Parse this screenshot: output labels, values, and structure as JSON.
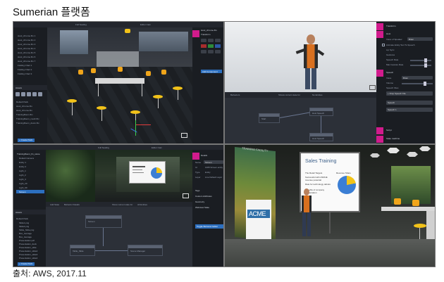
{
  "page": {
    "title": "Sumerian 플랫폼",
    "caption": "출처: AWS, 2017.11"
  },
  "editor1": {
    "toolbar": {
      "camera": "Full Seating",
      "editor_cam": "Editor Cam"
    },
    "inspector": {
      "file_name": "stool_chrome.fbx",
      "section": "Transform",
      "button": "Add Component"
    },
    "entities": [
      "stool_chrome.fbx 1",
      "stool_chrome.fbx 2",
      "stool_chrome.fbx 3",
      "stool_chrome.fbx 4",
      "stool_chrome.fbx 5",
      "stool_chrome.fbx 6",
      "stool_chrome.fbx 7",
      "Folding Chair 1",
      "Folding Chair 2",
      "Folding Chair 3"
    ],
    "assets_label": "Assets",
    "assets": [
      "Default Pack",
      "stool_chrome.fbx",
      "stool_chrome.fbx",
      "TrainingRoom.fbx",
      "TrainingRoom_mesh.fbx",
      "TrainingRoom_doors.fbx"
    ],
    "create_pack": "+ Create Pack"
  },
  "editor2": {
    "panel": {
      "section_transform": "Transform",
      "section_host": "Host",
      "voice_label": "Voice of Speaker",
      "voice_value": "Brian",
      "option1": "Animate Entity Text To Speech",
      "option2": "Lip Sync",
      "option3": "Gestures",
      "option4": "Speech Rate",
      "option5": "Max Gesture Rate",
      "section_speech": "Speech",
      "voice2_label": "Voice",
      "voice2_value": "Brian",
      "volume_label": "Volume",
      "speech_files": "Speech Files",
      "drop_label": "+ Drop Speech File",
      "speech1": "Speech",
      "speech2": "Speech 1",
      "section_script": "Script",
      "section_state": "State machine"
    },
    "lower_toolbar": {
      "tab1": "Behaviors",
      "tab2": "Shows current state for",
      "tab3": "No Entities"
    },
    "nodes": [
      "Start",
      "Host Speech",
      "Host Speech"
    ]
  },
  "editor3": {
    "toolbar": {
      "camera": "Full Seating",
      "editor_cam": "Editor Cam"
    },
    "entities": [
      "TrainingRoom_fin_stone",
      "Default Camera",
      "Entity 1",
      "Entity 2",
      "Light_1",
      "Light_2",
      "Light_3",
      "Light_20",
      "Light_99",
      "Screen"
    ],
    "inspector": {
      "section_details": "Details",
      "name_label": "Name",
      "name_value": "Screen",
      "id_label": "Id",
      "id_value": "1005.Screen.entity",
      "type_label": "Type",
      "type_value": "Entity",
      "layer_label": "Layer",
      "layer_value": "Live Default Layer",
      "section_tags": "Tags",
      "section_attributes": "Custom Attributes",
      "section_geometry": "Geometry",
      "section_webview": "Webview State",
      "button": "Toggle Behavior Editor"
    },
    "lower_toolbar": {
      "tab1": "Add State",
      "tab2": "Behavior Details",
      "tab3": "Show current state for",
      "tab4": "All Entities"
    },
    "nodes": [
      "Screen",
      "Table_Slide",
      "Scene Manager"
    ],
    "assets_label": "Assets",
    "assets": [
      "Default Pack",
      "Slide1.png",
      "Slide2.png",
      "Table_Slide.png",
      "Box_Average",
      "Box_Average",
      "Presentation.pdf",
      "Presentation_deck",
      "Presentation_slide",
      "Presentation_slide2",
      "Presentation_slide3",
      "Presentation_slide4"
    ],
    "create_pack": "+ Create Pack"
  },
  "scene4": {
    "banner": "TRAINING FACILITY",
    "slide_title": "Sales Training",
    "bullet1": "The Retail Targets",
    "bullet2": "Successful with ASDUE revenue potential",
    "bullet3": "Rate for technology debuts",
    "bullet4": "Benefits of company presentation",
    "pie_label": "Revenue Share",
    "logo": "ACME"
  },
  "colors": {
    "accent_magenta": "#d11b8c",
    "accent_blue": "#2c6fbf",
    "stool_yellow": "#f2c219",
    "chair_orange": "#f0a51a",
    "pie_blue": "#3b7ed4",
    "pie_yellow": "#f2c419"
  }
}
